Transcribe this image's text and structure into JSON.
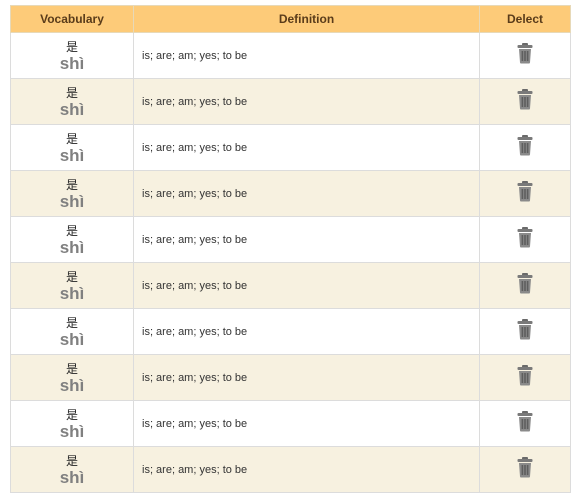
{
  "table": {
    "headers": {
      "vocabulary": "Vocabulary",
      "definition": "Definition",
      "delete": "Delect"
    },
    "rows": [
      {
        "hanzi": "是",
        "pinyin": "shì",
        "definition": "is; are; am; yes; to be"
      },
      {
        "hanzi": "是",
        "pinyin": "shì",
        "definition": "is; are; am; yes; to be"
      },
      {
        "hanzi": "是",
        "pinyin": "shì",
        "definition": "is; are; am; yes; to be"
      },
      {
        "hanzi": "是",
        "pinyin": "shì",
        "definition": "is; are; am; yes; to be"
      },
      {
        "hanzi": "是",
        "pinyin": "shì",
        "definition": "is; are; am; yes; to be"
      },
      {
        "hanzi": "是",
        "pinyin": "shì",
        "definition": "is; are; am; yes; to be"
      },
      {
        "hanzi": "是",
        "pinyin": "shì",
        "definition": "is; are; am; yes; to be"
      },
      {
        "hanzi": "是",
        "pinyin": "shì",
        "definition": "is; are; am; yes; to be"
      },
      {
        "hanzi": "是",
        "pinyin": "shì",
        "definition": "is; are; am; yes; to be"
      },
      {
        "hanzi": "是",
        "pinyin": "shì",
        "definition": "is; are; am; yes; to be"
      }
    ],
    "delete_icon": "trash-icon"
  },
  "colors": {
    "header_bg": "#fdcb79",
    "row_alt_bg": "#f7f1e0",
    "pinyin_text": "#808080"
  }
}
